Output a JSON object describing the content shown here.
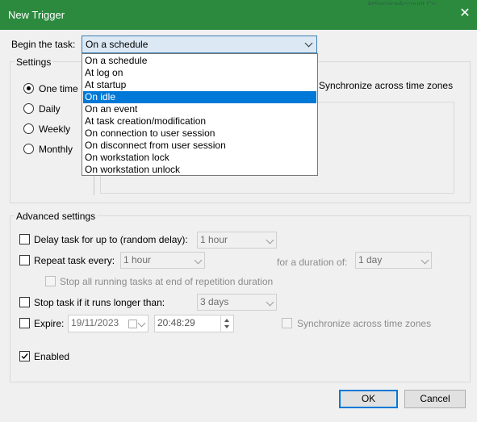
{
  "window": {
    "title": "New Trigger",
    "close_icon": "close-icon",
    "background_text": "AtServiceAccount Co"
  },
  "begin": {
    "label": "Begin the task:",
    "selected": "On a schedule",
    "options": [
      "On a schedule",
      "At log on",
      "At startup",
      "On idle",
      "On an event",
      "At task creation/modification",
      "On connection to user session",
      "On disconnect from user session",
      "On workstation lock",
      "On workstation unlock"
    ],
    "highlighted_index": 3
  },
  "settings": {
    "legend": "Settings",
    "radios": [
      "One time",
      "Daily",
      "Weekly",
      "Monthly"
    ],
    "selected_radio": "One time",
    "sync_label": "Synchronize across time zones"
  },
  "advanced": {
    "legend": "Advanced settings",
    "delay_label": "Delay task for up to (random delay):",
    "delay_value": "1 hour",
    "repeat_label": "Repeat task every:",
    "repeat_value": "1 hour",
    "duration_label": "for a duration of:",
    "duration_value": "1 day",
    "stop_all_label": "Stop all running tasks at end of repetition duration",
    "stop_long_label": "Stop task if it runs longer than:",
    "stop_long_value": "3 days",
    "expire_label": "Expire:",
    "expire_date": "19/11/2023",
    "expire_time": "20:48:29",
    "expire_sync_label": "Synchronize across time zones",
    "enabled_label": "Enabled",
    "enabled_checked": true
  },
  "buttons": {
    "ok": "OK",
    "cancel": "Cancel"
  },
  "colors": {
    "titlebar": "#2b8a3e",
    "selection": "#0078d7"
  }
}
